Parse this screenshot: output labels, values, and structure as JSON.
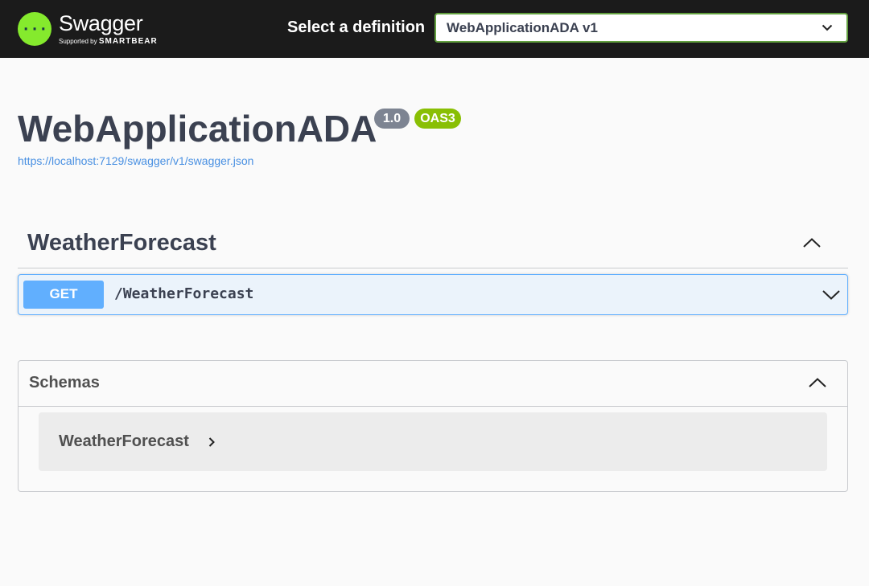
{
  "topbar": {
    "logo": {
      "title": "Swagger",
      "supported_by": "Supported by",
      "brand": "SMARTBEAR",
      "icon": "swagger-logo-icon",
      "color": "#85ea2d"
    },
    "definition_label": "Select a definition",
    "definition_selected": "WebApplicationADA v1"
  },
  "info": {
    "title": "WebApplicationADA",
    "version_badge": "1.0",
    "oas_badge": "OAS3",
    "spec_url": "https://localhost:7129/swagger/v1/swagger.json"
  },
  "tags": [
    {
      "name": "WeatherForecast",
      "expanded": true,
      "operations": [
        {
          "method": "GET",
          "path": "/WeatherForecast",
          "method_color": "#61affe"
        }
      ]
    }
  ],
  "schemas": {
    "title": "Schemas",
    "expanded": true,
    "models": [
      {
        "name": "WeatherForecast"
      }
    ]
  },
  "colors": {
    "topbar_bg": "#1b1b1b",
    "select_border": "#62a03f",
    "get_method": "#61affe",
    "get_bg": "#ebf3fb",
    "badge_version": "#7d8492",
    "badge_oas": "#89bf04",
    "link": "#4990e2"
  }
}
